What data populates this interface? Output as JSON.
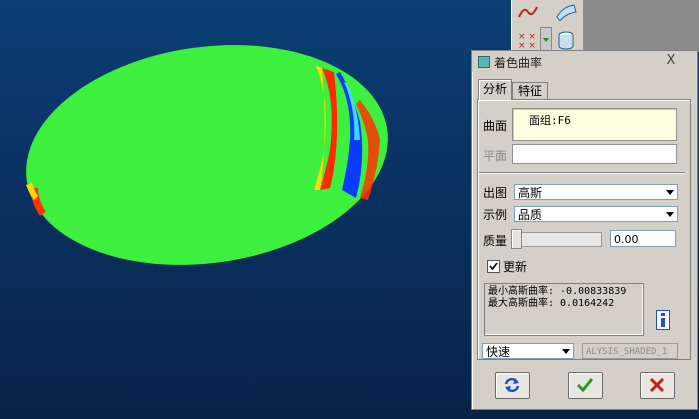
{
  "dialog": {
    "title": "着色曲率",
    "close_label": "X",
    "tabs": [
      {
        "label": "分析",
        "active": true
      },
      {
        "label": "特征",
        "active": false
      }
    ],
    "surface": {
      "label": "曲面",
      "value": "面组:F6"
    },
    "plane": {
      "label": "平面",
      "value": ""
    },
    "plot": {
      "label": "出图",
      "value": "高斯"
    },
    "example": {
      "label": "示例",
      "value": "品质"
    },
    "quality": {
      "label": "质量",
      "value": "0.00",
      "slider_level": 0
    },
    "update": {
      "label": "更新",
      "checked": true
    },
    "results": {
      "min_line": "最小高斯曲率: -0.00833839",
      "max_line": "最大高斯曲率: 0.0164242"
    },
    "speed": {
      "value": "快速"
    },
    "analysis_name": "ALYSIS_SHADED_1"
  },
  "icons": {
    "title": "surface-analysis-icon",
    "info": "info-icon",
    "repeat": "repeat-icon",
    "ok": "ok-checkmark-icon",
    "cancel": "cancel-x-icon",
    "toolbar": [
      "curve-icon",
      "surface-icon",
      "points-icon",
      "dropdown-arrow-icon",
      "cylinder-icon"
    ]
  },
  "colors": {
    "viewport_bg": "#0a3161",
    "surface_green": "#33ff33",
    "high_curvature": "#ff2200",
    "low_curvature": "#0044ff",
    "ok_green": "#2a9a2a",
    "cancel_red": "#c81e1e",
    "info_blue": "#1e50c8"
  }
}
